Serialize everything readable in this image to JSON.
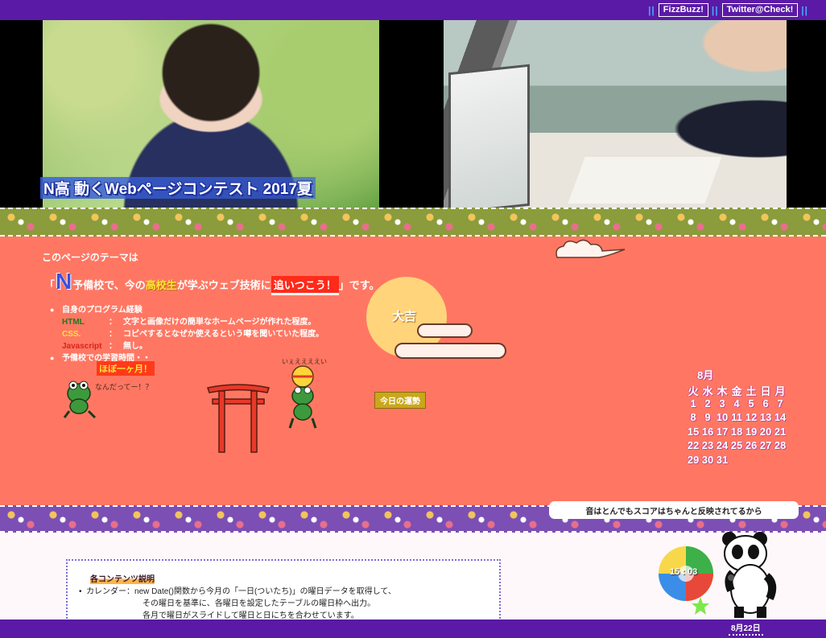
{
  "header": {
    "links": [
      {
        "label": "FizzBuzz!"
      },
      {
        "label": "Twitter@Check!"
      }
    ],
    "separator": "||"
  },
  "hero": {
    "title": "N高 動くWebページコンテスト 2017夏"
  },
  "theme": {
    "label": "このページのテーマは",
    "open_quote": "「",
    "n_letter": "N",
    "part1": "予備校で、今の",
    "highlight1": "高校生",
    "part2": "が学ぶウェブ技術に",
    "highlight2": "追いつこう！",
    "close_quote": "」",
    "part3": "です。"
  },
  "experience": {
    "heading": "自身のプログラム経験",
    "items": [
      {
        "lang": "HTML",
        "colon": "：",
        "text": "文字と画像だけの簡単なホームページが作れた程度。"
      },
      {
        "lang": "CSS.",
        "colon": "：",
        "text": "コピペするとなぜか使えるという噂を聞いていた程度。"
      },
      {
        "lang": "Javascript",
        "colon": "：",
        "text": "無し。"
      }
    ],
    "study_heading": "予備校での学習時間・・",
    "study_value": "ほぼ一ヶ月！"
  },
  "illustrations": {
    "frog_left_caption": "なんだってー！？",
    "frog_right_caption": "いぇええええい"
  },
  "fortune": {
    "result": "大吉",
    "button_label": "今日の運勢"
  },
  "calendar": {
    "month": "8月",
    "weekdays": [
      "火",
      "水",
      "木",
      "金",
      "土",
      "日",
      "月"
    ],
    "rows": [
      [
        "1",
        "2",
        "3",
        "4",
        "5",
        "6",
        "7"
      ],
      [
        "8",
        "9",
        "10",
        "11",
        "12",
        "13",
        "14"
      ],
      [
        "15",
        "16",
        "17",
        "18",
        "19",
        "20",
        "21"
      ],
      [
        "22",
        "23",
        "24",
        "25",
        "26",
        "27",
        "28"
      ],
      [
        "29",
        "30",
        "31",
        "",
        "",
        "",
        ""
      ]
    ]
  },
  "banner": {
    "text": "音はとんでもスコアはちゃんと反映されてるから"
  },
  "contents": {
    "title": "各コンテンツ説明",
    "line1": "カレンダー：new Date()関数から今月の「一日(ついたち)」の曜日データを取得して、",
    "line2": "その曜日を基準に、各曜日を設定したテーブルの曜日枠へ出力。",
    "line3": "各月で曜日がスライドして曜日と日にちを合わせています。"
  },
  "game": {
    "timer": "15 : 03"
  },
  "footer": {
    "date": "8月22日"
  },
  "colors": {
    "header_purple": "#5a1aa6",
    "coral": "#ff7763",
    "strip_purple": "#7c4fb5"
  }
}
